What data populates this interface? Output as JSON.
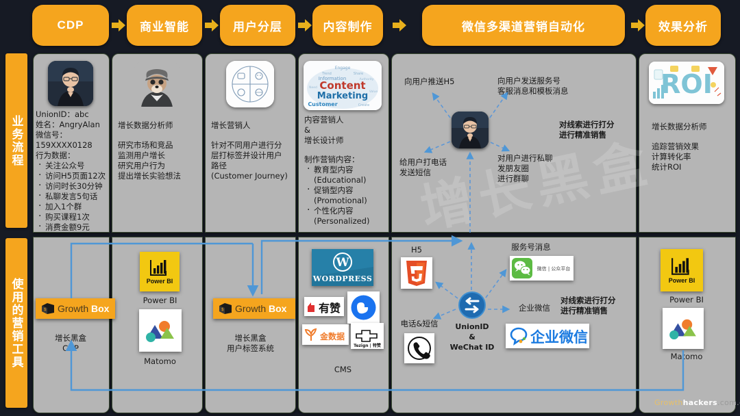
{
  "background_color": "#161a24",
  "accent_color": "#f5a51e",
  "panel_color": "#b5b5b5",
  "arrow_color": "#4f97d6",
  "header": {
    "stages": [
      {
        "label": "CDP"
      },
      {
        "label": "商业智能"
      },
      {
        "label": "用户分层"
      },
      {
        "label": "内容制作"
      },
      {
        "label": "微信多渠道营销自动化"
      },
      {
        "label": "效果分析"
      }
    ]
  },
  "row_labels": {
    "process": "业务流程",
    "tools": "使用的营销工具"
  },
  "process_row": {
    "cdp": {
      "avatar_name": "person-avatar-angryalan",
      "lines": [
        "UnionID：abc",
        "姓名：AngryAlan",
        "微信号：",
        "159XXXX0128",
        "行为数据："
      ],
      "bullets": [
        "关注公众号",
        "访问H5页面12次",
        "访问时长30分钟",
        "私聊发言5句话",
        "加入1个群",
        "购买课程1次",
        "消费金额9元"
      ]
    },
    "bi": {
      "avatar_name": "shiba-dog-avatar",
      "role": "增长数据分析师",
      "tasks": [
        "研究市场和竞品",
        "监测用户增长",
        "研究用户行为",
        "提出增长实验想法"
      ]
    },
    "segmentation": {
      "icon_name": "persona-quadrant-icon",
      "role": "增长营销人",
      "tasks": [
        "针对不同用户进行分",
        "层打标签并设计用户",
        "路径",
        "(Customer Journey)"
      ]
    },
    "content": {
      "icon_name": "content-marketing-wordcloud",
      "role_lines": [
        "内容营销人",
        "&",
        "增长设计师"
      ],
      "tasks_title": "制作营销内容：",
      "tasks": [
        {
          "cn": "教育型内容",
          "en": "(Educational)"
        },
        {
          "cn": "促销型内容",
          "en": "(Promotional)"
        },
        {
          "cn": "个性化内容",
          "en": "(Personalized)"
        }
      ]
    },
    "automation": {
      "avatar_name": "person-avatar-center",
      "watermark": "增长黑盒",
      "annotations": {
        "push_h5": "向用户推送H5",
        "service_msg": "向用户发送服务号\n客服消息和模板消息",
        "call_sms": "给用户打电话\n发送短信",
        "private_chat": "对用户进行私聊\n发朋友圈\n进行群聊",
        "scoring": "对线索进行打分\n进行精准销售"
      }
    },
    "analytics": {
      "icon_name": "roi-illustration-icon",
      "role": "增长数据分析师",
      "tasks": [
        "追踪营销效果",
        "计算转化率",
        "统计ROI"
      ]
    }
  },
  "tools_row": {
    "cdp": {
      "logo_label": "GrowthBox",
      "caption": "增长黑盒\nCDP"
    },
    "bi": {
      "powerbi_label": "Power BI",
      "powerbi_caption": "Power BI",
      "matomo_caption": "Matomo"
    },
    "segmentation": {
      "logo_label": "GrowthBox",
      "caption": "增长黑盒\n用户标签系统"
    },
    "content": {
      "logos": [
        "WordPress",
        "有赞",
        "Duck",
        "金数据",
        "Tezign | 特赞"
      ],
      "caption": "CMS"
    },
    "automation": {
      "h5_label": "H5",
      "phone_sms_label": "电话&短信",
      "service_account_label": "服务号消息",
      "wechat_logo_text": "微信 | 公众平台",
      "work_wechat_label": "企业微信",
      "work_wechat_logo_text": "企业微信",
      "hub_lines": [
        "UnionID",
        "&",
        "WeChat ID"
      ],
      "scoring_note": "对线索进行打分\n进行精准销售"
    },
    "analytics": {
      "powerbi_label": "Power BI",
      "powerbi_caption": "Power BI",
      "matomo_caption": "Matomo"
    }
  },
  "footer_watermark": {
    "a": "Growth",
    "b": "hackers",
    "c": ".com.cn"
  }
}
